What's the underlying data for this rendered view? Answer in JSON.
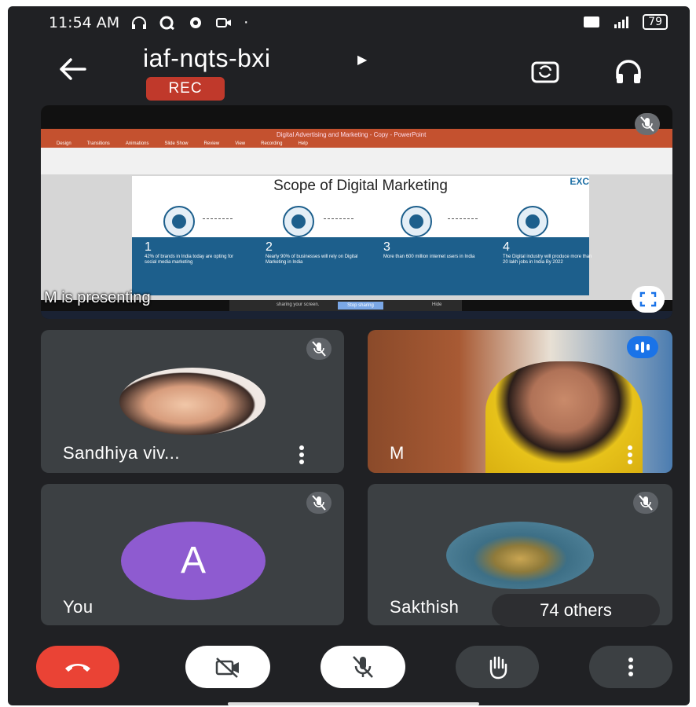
{
  "status_bar": {
    "time": "11:54 AM",
    "battery": "79"
  },
  "meeting": {
    "code": "iaf-nqts-bxi",
    "recording_badge": "REC"
  },
  "presentation": {
    "presenter_label": "M is presenting",
    "window_title": "Digital Advertising and Marketing - Copy - PowerPoint",
    "ribbon_tabs": [
      "Design",
      "Transitions",
      "Animations",
      "Slide Show",
      "Review",
      "View",
      "Recording",
      "Help"
    ],
    "slide": {
      "title": "Scope of Digital Marketing",
      "logo": "EXC",
      "stats": [
        {
          "number": "1",
          "text": "42% of brands in India today are opting for social media marketing"
        },
        {
          "number": "2",
          "text": "Nearly 90% of businesses will rely on Digital Marketing in India"
        },
        {
          "number": "3",
          "text": "More than 600 million internet users in India"
        },
        {
          "number": "4",
          "text": "The Digital industry will produce more than 20 lakh jobs in India By 2022"
        }
      ]
    },
    "share_bar": {
      "text": "sharing your screen.",
      "stop_label": "Stop sharing",
      "hide_label": "Hide"
    }
  },
  "participants": [
    {
      "name": "Sandhiya viv...",
      "muted": true
    },
    {
      "name": "M",
      "speaking": true
    },
    {
      "name": "You",
      "initial": "A",
      "avatar_color": "#8e5bd0",
      "muted": true
    },
    {
      "name": "Sakthish",
      "muted": true
    }
  ],
  "others_badge": "74 others",
  "colors": {
    "background": "#202124",
    "tile": "#3c4043",
    "end_call": "#ea4335",
    "rec": "#c0392b"
  }
}
